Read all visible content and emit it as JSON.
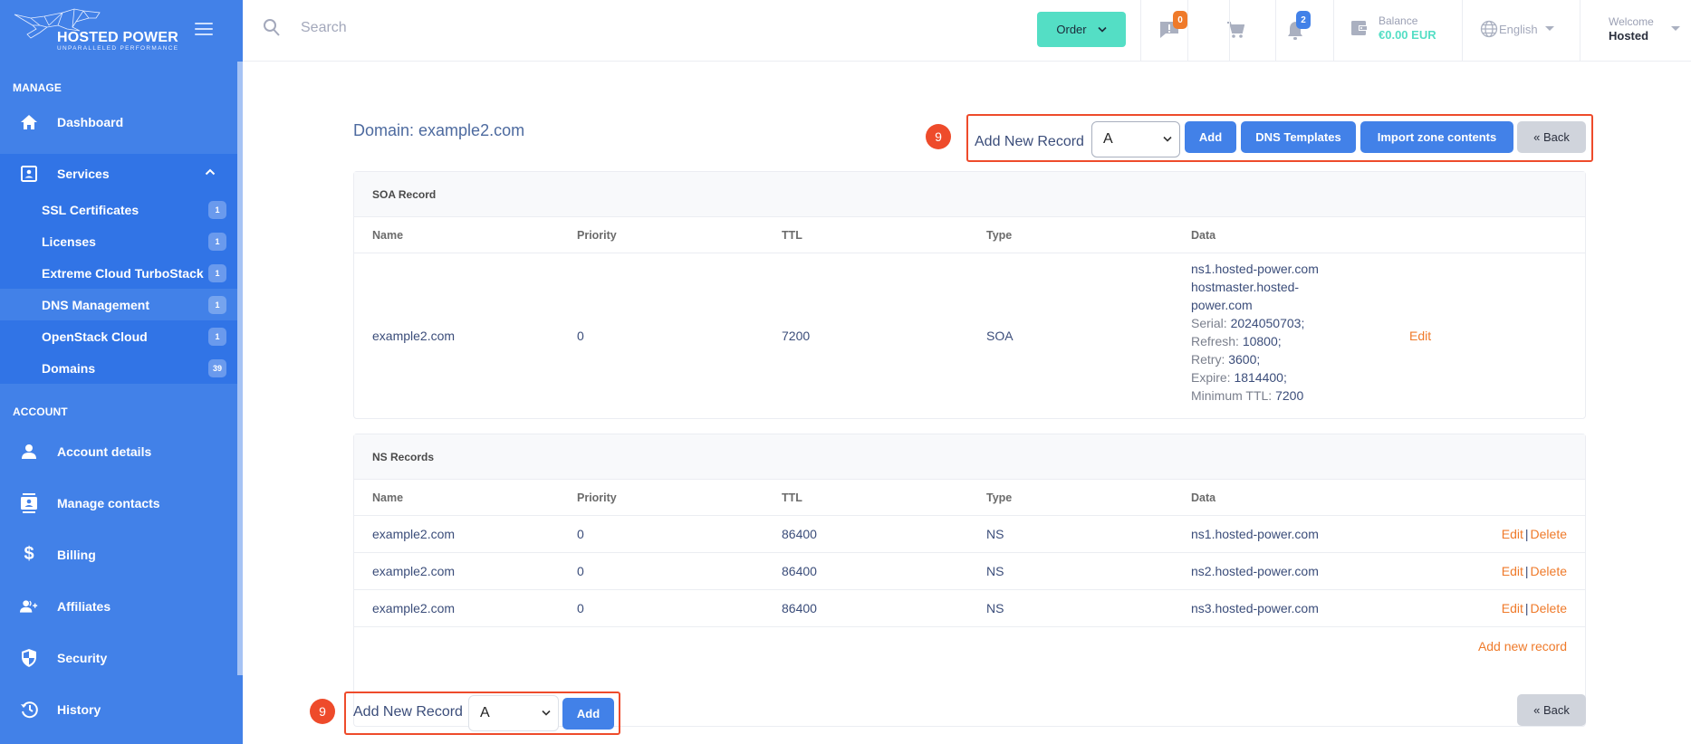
{
  "brand": {
    "name": "HOSTED POWER",
    "tagline": "UNPARALLELED PERFORMANCE",
    "logo_icon": "cheetah-logo-icon",
    "menu_icon": "hamburger-icon"
  },
  "sidebar": {
    "manage_label": "MANAGE",
    "account_label": "ACCOUNT",
    "manage_items": [
      {
        "label": "Dashboard",
        "icon": "home-icon"
      }
    ],
    "services": {
      "label": "Services",
      "icon": "contact-card-icon",
      "expanded": true,
      "items": [
        {
          "label": "SSL Certificates",
          "count": "1"
        },
        {
          "label": "Licenses",
          "count": "1"
        },
        {
          "label": "Extreme Cloud TurboStack",
          "count": "1"
        },
        {
          "label": "DNS Management",
          "count": "1",
          "active": true
        },
        {
          "label": "OpenStack Cloud",
          "count": "1"
        },
        {
          "label": "Domains",
          "count": "39"
        }
      ]
    },
    "account_items": [
      {
        "label": "Account details",
        "icon": "user-icon"
      },
      {
        "label": "Manage contacts",
        "icon": "contacts-icon"
      },
      {
        "label": "Billing",
        "icon": "dollar-icon"
      },
      {
        "label": "Affiliates",
        "icon": "user-add-icon"
      },
      {
        "label": "Security",
        "icon": "shield-icon"
      },
      {
        "label": "History",
        "icon": "history-icon"
      }
    ]
  },
  "topbar": {
    "search_placeholder": "Search",
    "order_label": "Order",
    "tickets_badge": "0",
    "notifications_badge": "2",
    "balance_label": "Balance",
    "balance_value": "€0.00 EUR",
    "language": "English",
    "welcome_label": "Welcome",
    "user_name": "Hosted",
    "colors": {
      "accent_green": "#54dec5",
      "badge_orange": "#ef7a2a",
      "badge_blue": "#4281e8"
    }
  },
  "page": {
    "title": "Domain: example2.com",
    "annotation_number": "9",
    "add_new_record_label": "Add New Record",
    "record_type_selected": "A",
    "add_button": "Add",
    "dns_templates_button": "DNS Templates",
    "import_zone_button": "Import zone contents",
    "back_button": "« Back"
  },
  "soa": {
    "title": "SOA Record",
    "columns": [
      "Name",
      "Priority",
      "TTL",
      "Type",
      "Data"
    ],
    "row": {
      "name": "example2.com",
      "priority": "0",
      "ttl": "7200",
      "type": "SOA",
      "primary_ns": "ns1.hosted-power.com",
      "hostmaster_line1": "hostmaster.hosted-",
      "hostmaster_line2": "power.com",
      "fields": [
        {
          "key": "Serial:",
          "value": "2024050703;"
        },
        {
          "key": "Refresh:",
          "value": "10800;"
        },
        {
          "key": "Retry:",
          "value": "3600;"
        },
        {
          "key": "Expire:",
          "value": "1814400;"
        },
        {
          "key": "Minimum TTL:",
          "value": "7200"
        }
      ],
      "edit": "Edit"
    }
  },
  "ns": {
    "title": "NS Records",
    "columns": [
      "Name",
      "Priority",
      "TTL",
      "Type",
      "Data"
    ],
    "rows": [
      {
        "name": "example2.com",
        "priority": "0",
        "ttl": "86400",
        "type": "NS",
        "data": "ns1.hosted-power.com",
        "edit": "Edit",
        "sep": "|",
        "delete": "Delete"
      },
      {
        "name": "example2.com",
        "priority": "0",
        "ttl": "86400",
        "type": "NS",
        "data": "ns2.hosted-power.com",
        "edit": "Edit",
        "sep": "|",
        "delete": "Delete"
      },
      {
        "name": "example2.com",
        "priority": "0",
        "ttl": "86400",
        "type": "NS",
        "data": "ns3.hosted-power.com",
        "edit": "Edit",
        "sep": "|",
        "delete": "Delete"
      }
    ],
    "add_new_record_link": "Add new record"
  }
}
